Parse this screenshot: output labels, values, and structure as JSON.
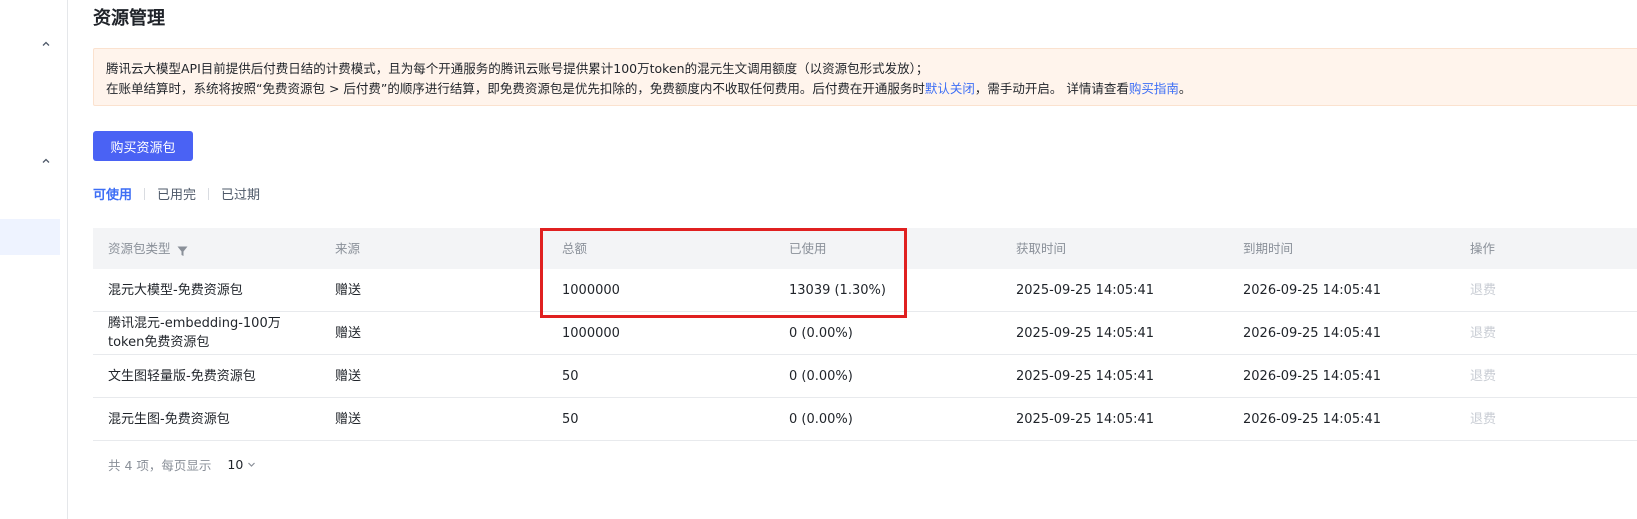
{
  "page": {
    "title": "资源管理"
  },
  "notice": {
    "line1": "腾讯云大模型API目前提供后付费日结的计费模式，且为每个开通服务的腾讯云账号提供累计100万token的混元生文调用额度（以资源包形式发放）；",
    "line2_a": "在账单结算时，系统将按照“免费资源包 > 后付费”的顺序进行结算，即免费资源包是优先扣除的，免费额度内不收取任何费用。后付费在开通服务时",
    "link_default_off": "默认关闭",
    "line2_b": "，需手动开启。 详情请查看",
    "link_guide": "购买指南",
    "line2_c": "。"
  },
  "toolbar": {
    "buy_label": "购买资源包"
  },
  "tabs": [
    {
      "label": "可使用",
      "active": true
    },
    {
      "label": "已用完",
      "active": false
    },
    {
      "label": "已过期",
      "active": false
    }
  ],
  "table": {
    "headers": [
      "资源包类型",
      "来源",
      "总额",
      "已使用",
      "获取时间",
      "到期时间",
      "操作"
    ],
    "rows": [
      {
        "type": "混元大模型-免费资源包",
        "source": "赠送",
        "total": "1000000",
        "used": "13039 (1.30%)",
        "acquired": "2025-09-25 14:05:41",
        "expires": "2026-09-25 14:05:41",
        "action": "退费"
      },
      {
        "type": "腾讯混元-embedding-100万token免费资源包",
        "source": "赠送",
        "total": "1000000",
        "used": "0 (0.00%)",
        "acquired": "2025-09-25 14:05:41",
        "expires": "2026-09-25 14:05:41",
        "action": "退费"
      },
      {
        "type": "文生图轻量版-免费资源包",
        "source": "赠送",
        "total": "50",
        "used": "0 (0.00%)",
        "acquired": "2025-09-25 14:05:41",
        "expires": "2026-09-25 14:05:41",
        "action": "退费"
      },
      {
        "type": "混元生图-免费资源包",
        "source": "赠送",
        "total": "50",
        "used": "0 (0.00%)",
        "acquired": "2025-09-25 14:05:41",
        "expires": "2026-09-25 14:05:41",
        "action": "退费"
      }
    ]
  },
  "pager": {
    "summary": "共 4 项，每页显示",
    "page_size": "10"
  },
  "icons": {
    "filter": "filter-icon",
    "chevron_up": "chevron-up-icon",
    "chevron_down": "chevron-down-icon"
  },
  "colors": {
    "accent": "#4a62f4",
    "link": "#3d6ef5",
    "notice_bg": "#fff4ec",
    "highlight": "#e02020"
  }
}
